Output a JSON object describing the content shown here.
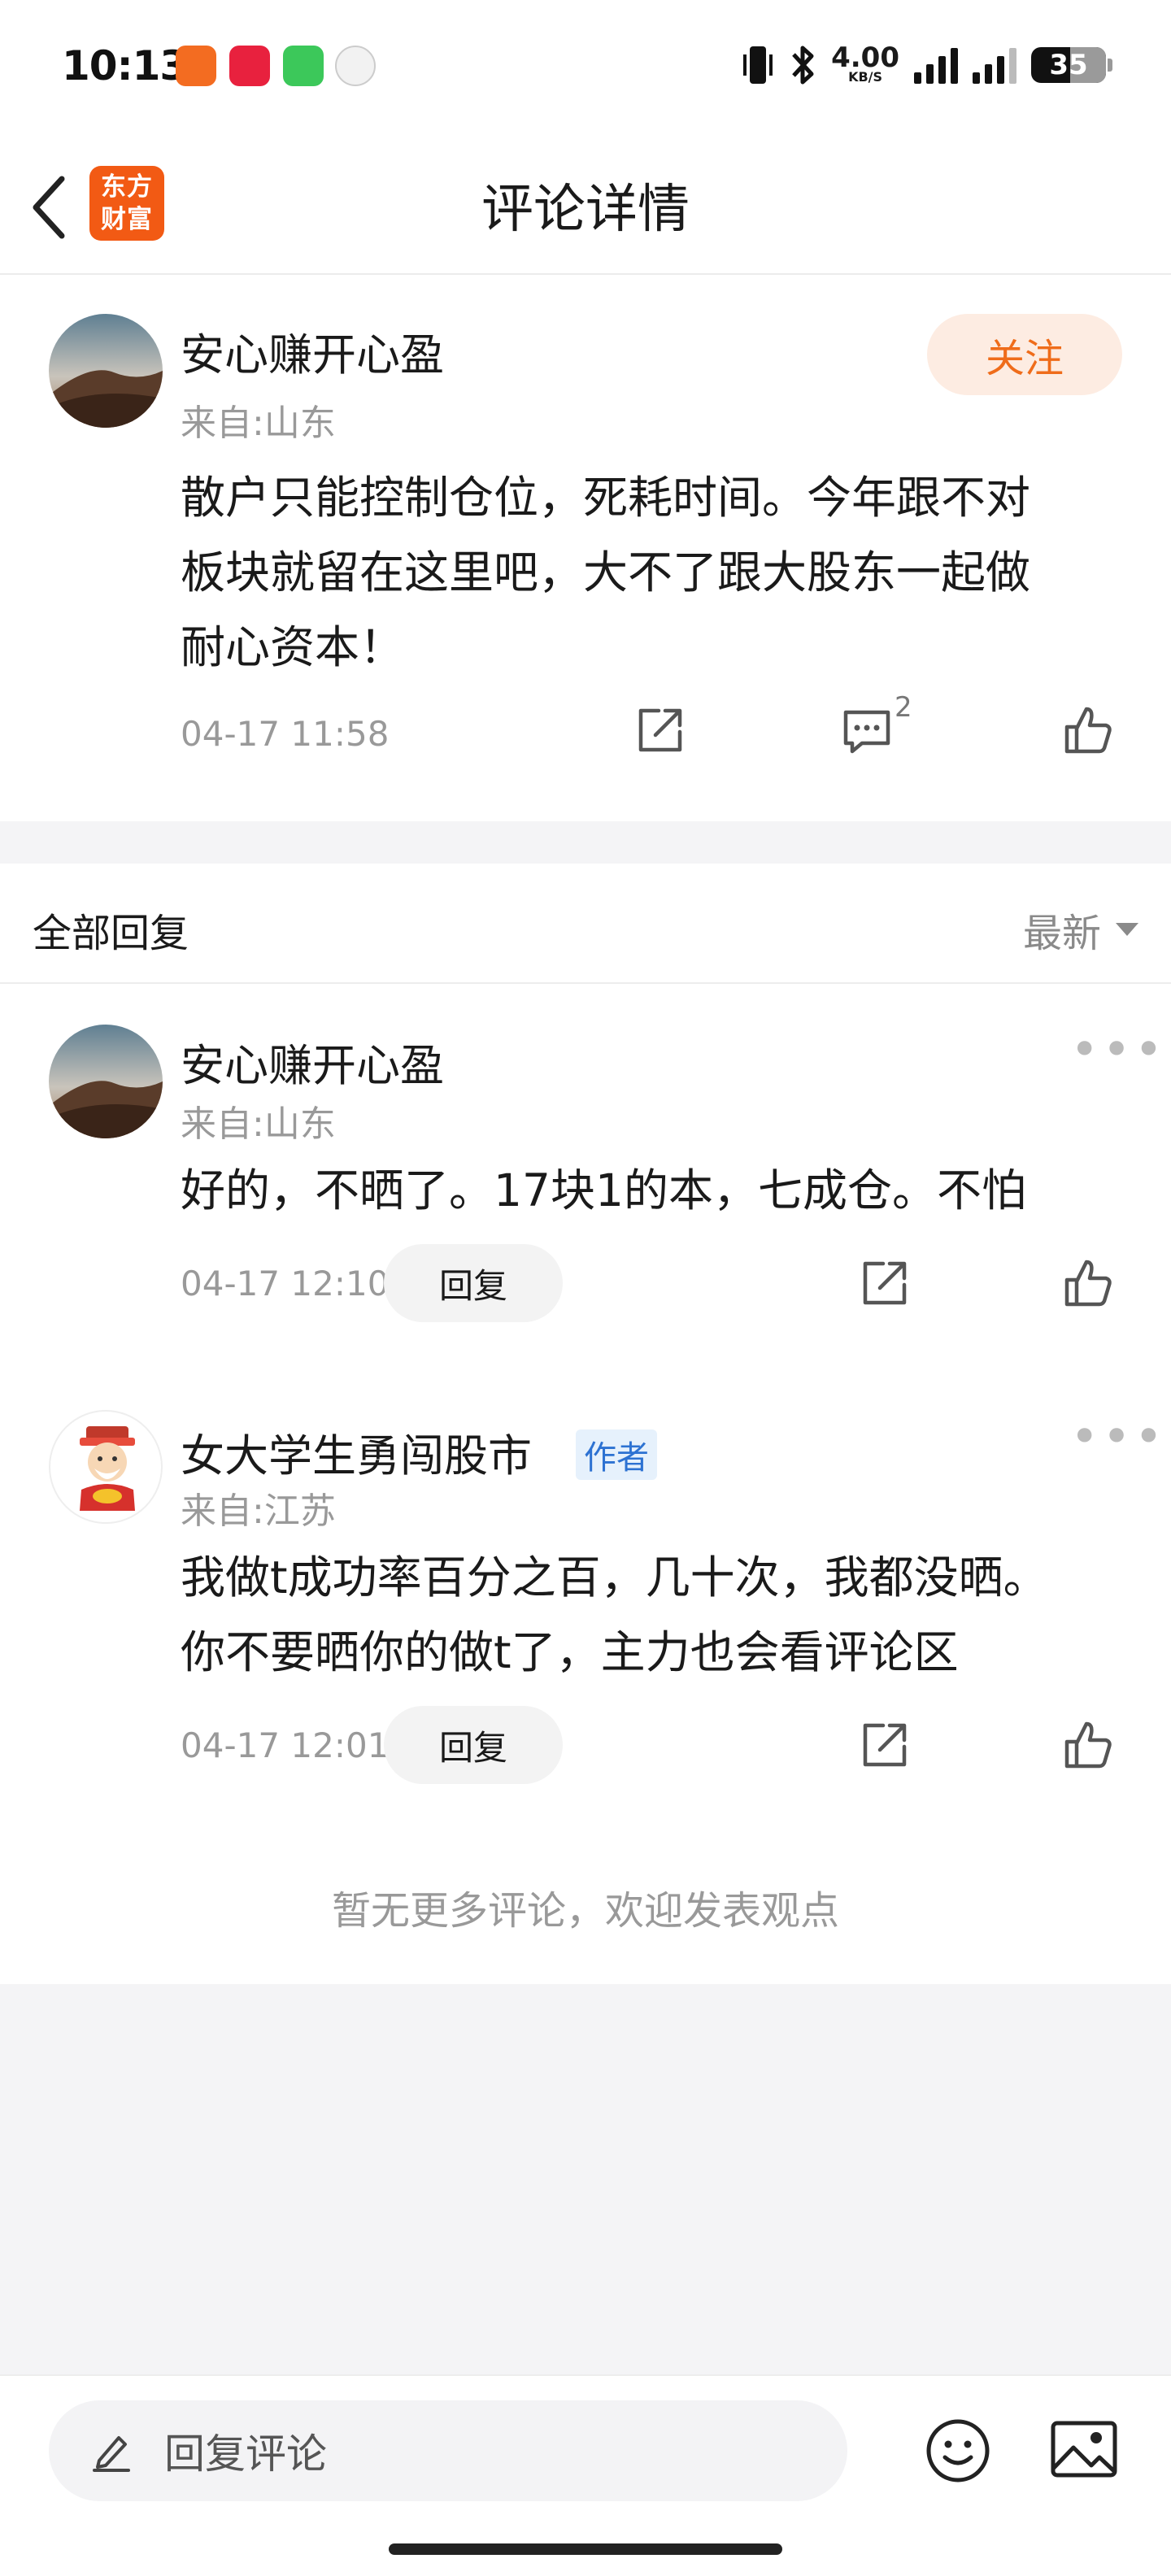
{
  "status_bar": {
    "time": "10:13",
    "net_speed": "4.00",
    "net_unit": "KB/S",
    "network_type": "4G",
    "battery": "35",
    "app_icons": [
      "news-app-icon",
      "shopping-app-icon",
      "messages-app-icon",
      "clock-app-icon"
    ]
  },
  "header": {
    "title": "评论详情",
    "logo_line1": "东方",
    "logo_line2": "财富",
    "accent": "#f25a14"
  },
  "main_comment": {
    "username": "安心赚开心盈",
    "location": "来自:山东",
    "follow_label": "关注",
    "content_lines": [
      "散户只能控制仓位，死耗时间。今年跟不对",
      "板块就留在这里吧，大不了跟大股东一起做",
      "耐心资本！"
    ],
    "timestamp": "04-17 11:58",
    "comment_count": "2"
  },
  "replies_header": {
    "title": "全部回复",
    "sort_label": "最新"
  },
  "replies": [
    {
      "username": "安心赚开心盈",
      "location": "来自:山东",
      "content_lines": [
        "好的，不晒了。17块1的本，七成仓。不怕"
      ],
      "timestamp": "04-17 12:10",
      "reply_label": "回复"
    },
    {
      "username": "女大学生勇闯股市",
      "badge": "作者",
      "location": "来自:江苏",
      "content_lines": [
        "我做t成功率百分之百，几十次，我都没晒。",
        "你不要晒你的做t了，主力也会看评论区"
      ],
      "timestamp": "04-17 12:01",
      "reply_label": "回复"
    }
  ],
  "no_more_text": "暂无更多评论，欢迎发表观点",
  "bottom_bar": {
    "input_placeholder": "回复评论"
  },
  "colors": {
    "follow_bg": "#fdece2",
    "follow_text": "#ef6c1a",
    "author_badge_text": "#2d72d2",
    "author_badge_bg": "#e6f1fc"
  }
}
